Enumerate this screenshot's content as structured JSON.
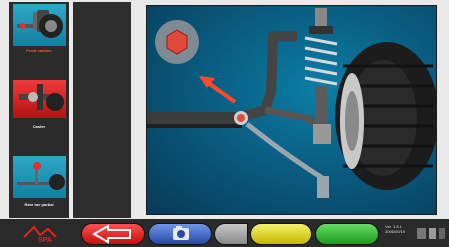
{
  "sidebar": {
    "items": [
      {
        "label": "Front camber",
        "icon": "suspension-arm-thumbnail"
      },
      {
        "label": "Caster",
        "icon": "steering-knuckle-thumbnail"
      },
      {
        "label": "Rear toe partial",
        "icon": "toe-link-thumbnail"
      }
    ]
  },
  "viewport": {
    "scene": "front-suspension-adjustment-illustration",
    "highlight_icon": "hex-bolt-icon",
    "pointer_icon": "red-arrow-icon"
  },
  "toolbar": {
    "logo_text": "SPA",
    "back_icon": "back-arrow-icon",
    "camera_icon": "camera-icon",
    "version_text": "Ver. 1.8.1",
    "version_sub": "2006/09/19",
    "colors": {
      "back": "#e52121",
      "camera": "#3b62c4",
      "yellow": "#e2d925",
      "green": "#33b933",
      "highlight": "#ff5a2b"
    }
  }
}
